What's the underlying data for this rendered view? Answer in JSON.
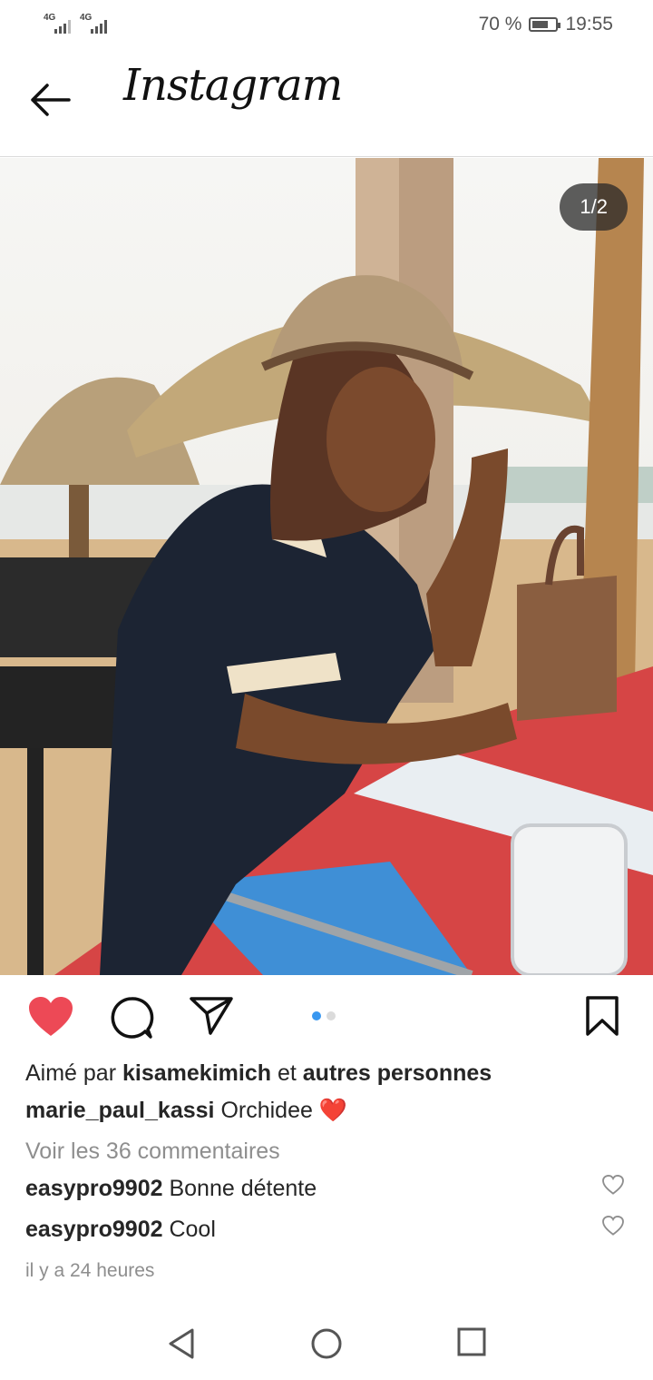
{
  "status_bar": {
    "network_1": "4G",
    "network_2": "4G",
    "battery_percent": "70 %",
    "battery_level": 0.7,
    "time": "19:55"
  },
  "header": {
    "back_icon": "arrow-left-icon",
    "logo": "Instagram"
  },
  "post": {
    "photo_counter": "1/2",
    "carousel_count": 2,
    "carousel_index": 1,
    "liked": true,
    "like_color": "#ed4956",
    "likes": {
      "prefix": "Aimé par",
      "user": "kisamekimich",
      "connector": "et",
      "others": "autres personnes"
    },
    "caption": {
      "user": "marie_paul_kassi",
      "text": "Orchidee",
      "emoji": "❤️"
    },
    "view_comments": "Voir les 36 commentaires",
    "comments": [
      {
        "user": "easypro9902",
        "text": "Bonne détente"
      },
      {
        "user": "easypro9902",
        "text": "Cool"
      }
    ],
    "time_ago": "il y a 24 heures"
  },
  "icons": {
    "like": "heart-icon",
    "comment": "comment-icon",
    "share": "send-icon",
    "save": "bookmark-icon"
  },
  "nav": {
    "back": "triangle-back-icon",
    "home": "circle-home-icon",
    "recents": "square-recents-icon"
  }
}
